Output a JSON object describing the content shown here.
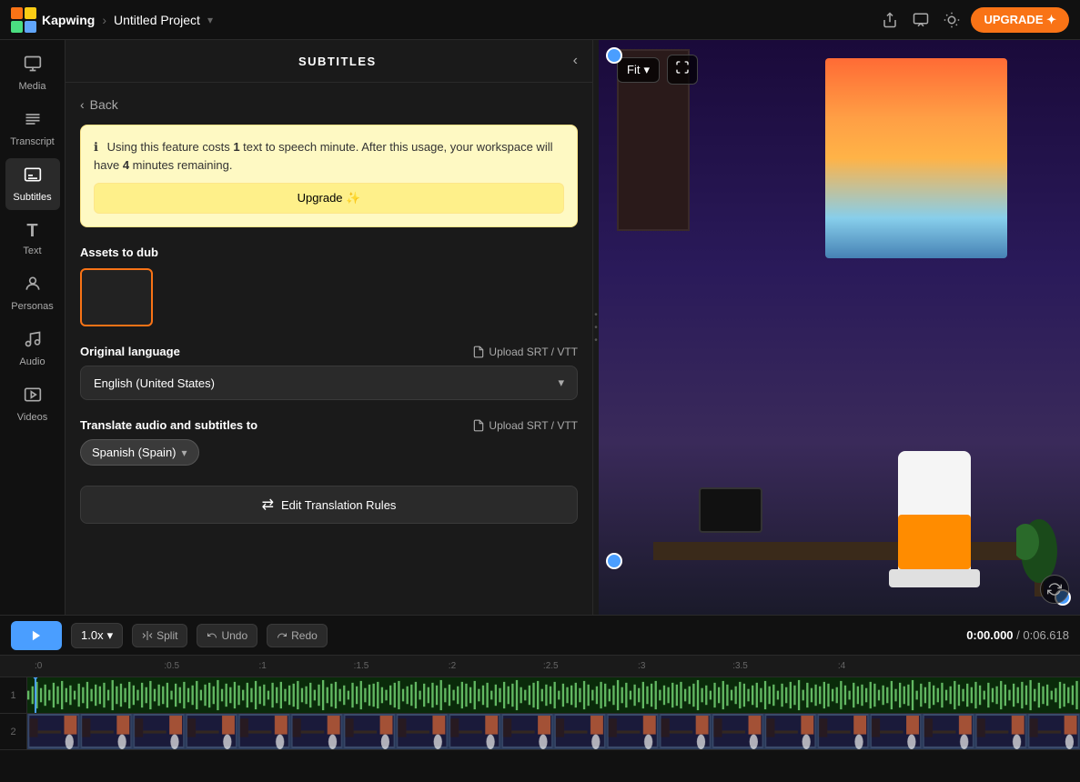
{
  "app": {
    "name": "Kapwing",
    "breadcrumb_sep": "›",
    "project_name": "Untitled Project"
  },
  "topbar": {
    "kapwing_label": "Kapwing",
    "project_label": "Untitled Project",
    "upgrade_label": "UPGRADE ✦"
  },
  "sidebar": {
    "items": [
      {
        "id": "media",
        "label": "Media",
        "icon": "⊞"
      },
      {
        "id": "transcript",
        "label": "Transcript",
        "icon": "≡"
      },
      {
        "id": "subtitles",
        "label": "Subtitles",
        "icon": "⊟",
        "active": true
      },
      {
        "id": "text",
        "label": "Text",
        "icon": "T"
      },
      {
        "id": "personas",
        "label": "Personas",
        "icon": "◉"
      },
      {
        "id": "audio",
        "label": "Audio",
        "icon": "♪"
      },
      {
        "id": "videos",
        "label": "Videos",
        "icon": "▣"
      }
    ]
  },
  "panel": {
    "title": "SUBTITLES",
    "back_label": "Back",
    "warning": {
      "text_before": "Using this feature costs ",
      "cost_amount": "1",
      "text_middle": " text to speech minute. After this usage, your workspace will have ",
      "remaining_amount": "4",
      "text_after": " minutes remaining.",
      "upgrade_label": "Upgrade ✨"
    },
    "assets_label": "Assets to dub",
    "original_language_label": "Original language",
    "upload_srt_label": "Upload SRT / VTT",
    "language_value": "English (United States)",
    "translate_label": "Translate audio and subtitles to",
    "translate_upload_label": "Upload SRT / VTT",
    "selected_language": "Spanish (Spain)",
    "edit_rules_label": "Edit Translation Rules"
  },
  "preview": {
    "fit_label": "Fit"
  },
  "timeline": {
    "time_current": "0:00.000",
    "time_separator": " / ",
    "time_total": "0:06.618",
    "ruler_marks": [
      ":0",
      ":0.5",
      ":1",
      ":1.5",
      ":2",
      ":2.5",
      ":3",
      ":3.5",
      ":4"
    ],
    "track1_label": "1",
    "track2_label": "2"
  },
  "controls": {
    "speed_label": "1.0x",
    "split_label": "⌂ Split",
    "undo_label": "↩ Undo",
    "redo_label": "↪ Redo"
  }
}
